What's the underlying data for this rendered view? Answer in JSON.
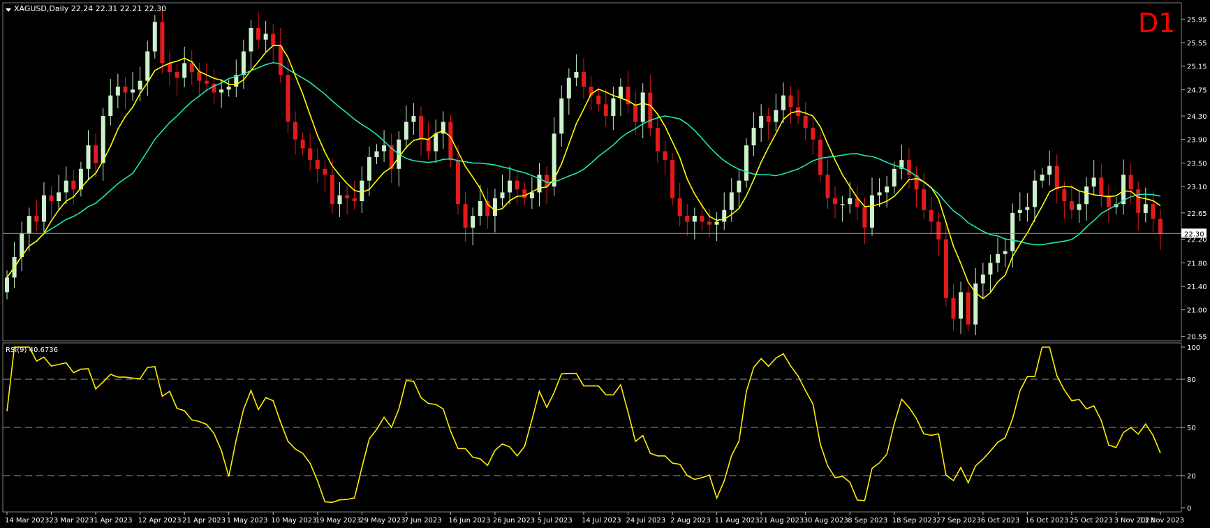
{
  "window": {
    "symbol_line": "XAGUSD,Daily  22.24 22.31 22.21 22.30",
    "timeframe_badge": "D1",
    "current_price_label": "22.30"
  },
  "indicator": {
    "label": "RSI(9) 40.6736",
    "levels": [
      80,
      50,
      20
    ],
    "axis_ticks": [
      "100",
      "80",
      "50",
      "20",
      "0"
    ]
  },
  "colors": {
    "background": "#000000",
    "bull_candle": "#ccf2cc",
    "bear_candle": "#e01b1b",
    "ma_fast": "#ffff00",
    "ma_slow": "#1ee6b4",
    "rsi": "#ffee00",
    "badge": "#ff0000"
  },
  "chart_data": {
    "type": "candlestick",
    "price_ticks": [
      "25.95",
      "25.55",
      "25.15",
      "24.75",
      "24.30",
      "23.90",
      "23.50",
      "23.10",
      "22.65",
      "22.20",
      "21.80",
      "21.40",
      "21.00",
      "20.55"
    ],
    "price_ylim": [
      20.52,
      26.18
    ],
    "current_price": 22.3,
    "date_ticks": [
      "14 Mar 2023",
      "23 Mar 2023",
      "1 Apr 2023",
      "12 Apr 2023",
      "21 Apr 2023",
      "1 May 2023",
      "10 May 2023",
      "19 May 2023",
      "29 May 2023",
      "7 Jun 2023",
      "16 Jun 2023",
      "26 Jun 2023",
      "5 Jul 2023",
      "14 Jul 2023",
      "24 Jul 2023",
      "2 Aug 2023",
      "11 Aug 2023",
      "21 Aug 2023",
      "30 Aug 2023",
      "8 Sep 2023",
      "18 Sep 2023",
      "27 Sep 2023",
      "6 Oct 2023",
      "16 Oct 2023",
      "25 Oct 2023",
      "3 Nov 2023",
      "13 Nov 2023"
    ],
    "closes": [
      21.55,
      21.9,
      22.3,
      22.6,
      22.5,
      22.95,
      22.85,
      23.0,
      23.2,
      23.05,
      23.4,
      23.8,
      23.5,
      24.3,
      24.65,
      24.8,
      24.7,
      24.75,
      24.9,
      25.4,
      25.9,
      25.2,
      25.05,
      24.95,
      25.2,
      25.05,
      24.9,
      24.85,
      24.7,
      24.75,
      24.8,
      25.0,
      25.4,
      25.8,
      25.6,
      25.7,
      25.5,
      25.0,
      24.2,
      23.9,
      23.75,
      23.55,
      23.4,
      23.3,
      22.8,
      22.95,
      22.9,
      22.85,
      23.2,
      23.6,
      23.7,
      23.8,
      23.4,
      23.9,
      24.2,
      24.3,
      23.9,
      23.7,
      24.0,
      24.2,
      23.55,
      22.8,
      22.4,
      22.6,
      22.85,
      22.6,
      22.9,
      23.0,
      23.2,
      23.05,
      22.9,
      23.0,
      23.3,
      23.1,
      24.0,
      24.6,
      24.95,
      25.05,
      24.8,
      24.65,
      24.5,
      24.3,
      24.6,
      24.8,
      24.5,
      24.2,
      24.7,
      24.1,
      23.7,
      23.55,
      22.9,
      22.6,
      22.5,
      22.6,
      22.5,
      22.45,
      22.5,
      22.7,
      23.0,
      23.2,
      23.8,
      24.1,
      24.3,
      24.2,
      24.4,
      24.65,
      24.45,
      24.3,
      24.1,
      23.9,
      23.3,
      22.9,
      22.8,
      22.8,
      22.9,
      22.75,
      22.4,
      22.95,
      23.0,
      23.1,
      23.4,
      23.55,
      23.3,
      23.05,
      22.7,
      22.5,
      22.2,
      21.2,
      20.85,
      21.3,
      20.75,
      21.45,
      21.6,
      21.8,
      21.95,
      22.0,
      22.65,
      22.7,
      22.75,
      23.2,
      23.3,
      23.45,
      23.05,
      22.85,
      22.7,
      22.8,
      23.1,
      23.25,
      22.95,
      22.75,
      22.8,
      23.3,
      23.05,
      22.65,
      22.8,
      22.55,
      22.3
    ]
  }
}
